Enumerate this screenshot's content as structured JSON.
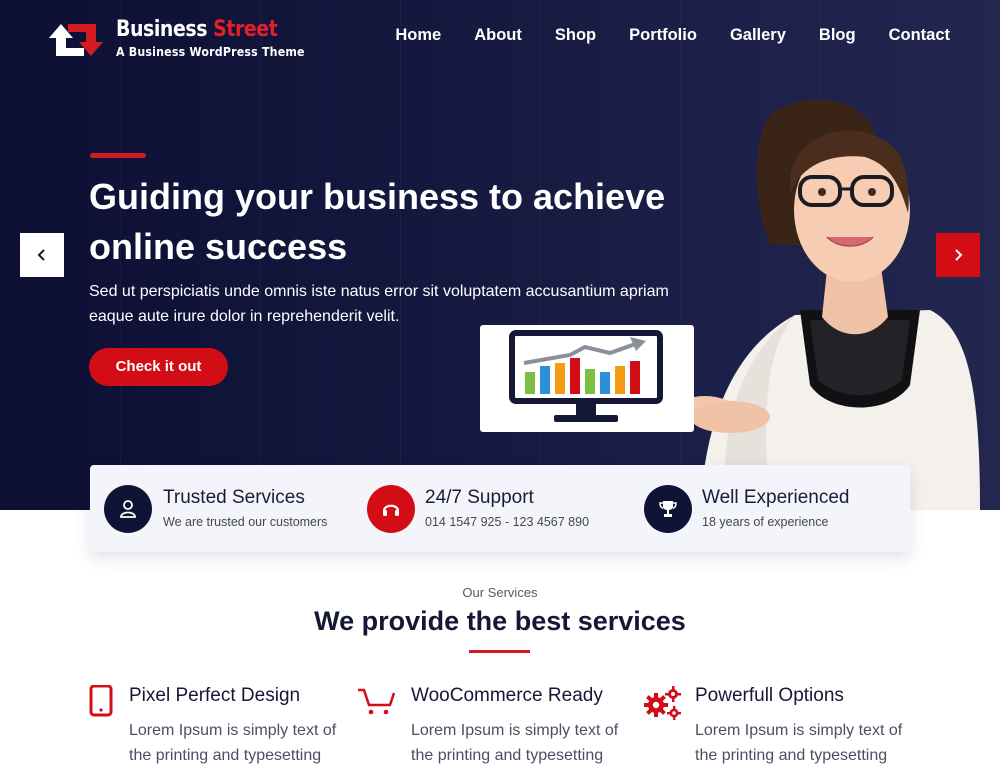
{
  "brand": {
    "title_main": "Business ",
    "title_accent": "Street",
    "tagline": "A Business WordPress Theme"
  },
  "nav": {
    "items": [
      "Home",
      "About",
      "Shop",
      "Portfolio",
      "Gallery",
      "Blog",
      "Contact"
    ]
  },
  "hero": {
    "title": "Guiding your business to achieve online success",
    "text": "Sed ut perspiciatis unde omnis iste natus error sit voluptatem accusantium apriam eaque aute irure dolor in reprehenderit velit.",
    "button": "Check it out"
  },
  "features": [
    {
      "title": "Trusted Services",
      "subtitle": "We are trusted our customers",
      "icon": "user-icon",
      "color": "#0f1336"
    },
    {
      "title": "24/7 Support",
      "subtitle": "014 1547 925 - 123 4567 890",
      "icon": "headset-icon",
      "color": "#d30d15"
    },
    {
      "title": "Well Experienced",
      "subtitle": "18 years of experience",
      "icon": "trophy-icon",
      "color": "#0f1336"
    }
  ],
  "services": {
    "tag": "Our Services",
    "title_bold": "We provide the",
    "title_light": " best services",
    "items": [
      {
        "title": "Pixel Perfect Design",
        "text": "Lorem Ipsum is simply text of the printing and typesetting",
        "icon": "tablet-icon"
      },
      {
        "title": "WooCommerce Ready",
        "text": "Lorem Ipsum is simply text of the printing and typesetting",
        "icon": "cart-icon"
      },
      {
        "title": "Powerfull Options",
        "text": "Lorem Ipsum is simply text of the printing and typesetting",
        "icon": "gears-icon"
      }
    ]
  },
  "colors": {
    "accent": "#d30d15",
    "navy": "#0f1336"
  }
}
